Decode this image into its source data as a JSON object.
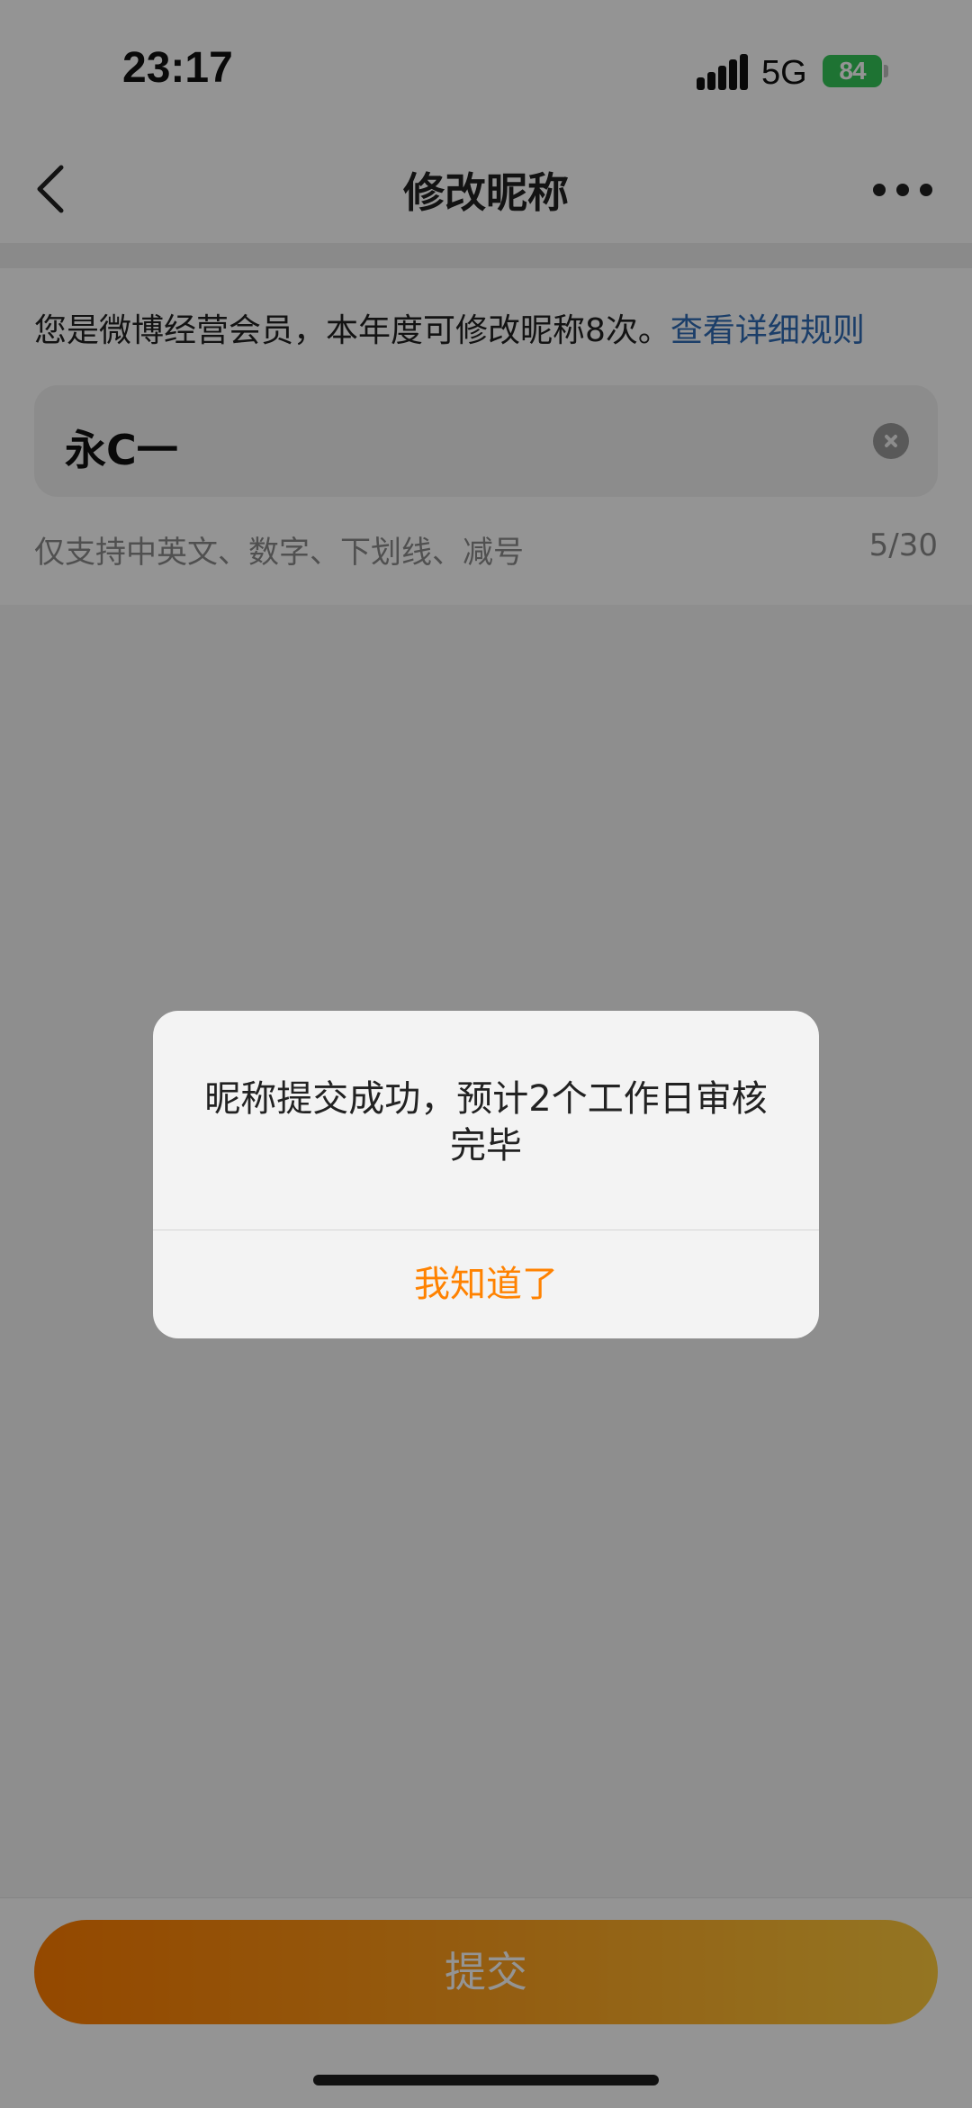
{
  "status_bar": {
    "time": "23:17",
    "network": "5G",
    "battery": "84",
    "battery_color": "#34c759"
  },
  "nav": {
    "title": "修改昵称",
    "back_icon": "chevron-left-icon",
    "more_icon": "more-dots-icon"
  },
  "notice": {
    "text": "您是微博经营会员，本年度可修改昵称8次。",
    "link": "查看详细规则",
    "link_color": "#2f6bb5"
  },
  "nickname_input": {
    "value": "永C一",
    "clear_icon": "clear-circle-icon"
  },
  "hint": {
    "text": "仅支持中英文、数字、下划线、减号",
    "counter": "5/30"
  },
  "submit": {
    "label": "提交",
    "gradient_start": "#ff7d00",
    "gradient_end": "#ffcb3d"
  },
  "dialog": {
    "message": "昵称提交成功，预计2个工作日审核完毕",
    "confirm_label": "我知道了",
    "confirm_color": "#ff8200"
  }
}
